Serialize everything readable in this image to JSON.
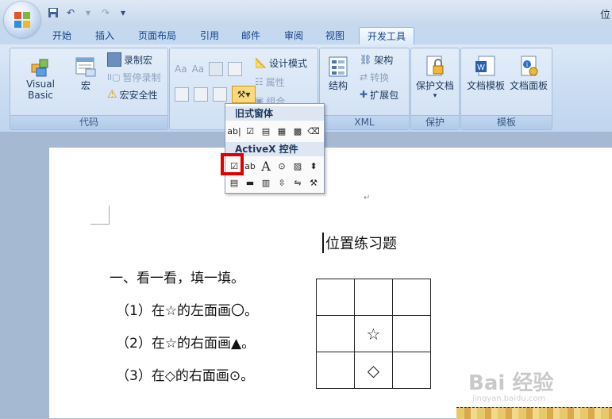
{
  "title_bar": {
    "title": "位"
  },
  "quick_access": {
    "icons": [
      "save-icon",
      "undo-icon",
      "redo-icon",
      "customize-icon"
    ]
  },
  "tabs": [
    "开始",
    "插入",
    "页面布局",
    "引用",
    "邮件",
    "审阅",
    "视图",
    "开发工具"
  ],
  "active_tab": "开发工具",
  "ribbon": {
    "code": {
      "label": "代码",
      "visual_basic": "Visual Basic",
      "macros": "宏",
      "record_macro": "录制宏",
      "pause_recording": "暂停录制",
      "macro_security": "宏安全性"
    },
    "controls": {
      "design_mode": "设计模式",
      "properties": "属性",
      "group": "组合"
    },
    "xml": {
      "label": "XML",
      "structure": "结构",
      "schema": "架构",
      "transform": "转换",
      "expansion_packs": "扩展包"
    },
    "protect": {
      "label": "保护",
      "protect_document": "保护文档"
    },
    "templates": {
      "label": "模板",
      "document_template": "文档模板",
      "document_panel": "文档面板"
    }
  },
  "dropdown": {
    "legacy_header": "旧式窗体",
    "activex_header": "ActiveX 控件",
    "legacy_icons": [
      "text-field-icon",
      "checkbox-icon",
      "combobox-icon",
      "frame-icon",
      "shading-icon",
      "eraser-icon"
    ],
    "activex_row1": [
      "checkbox-icon",
      "textbox-icon",
      "label-icon",
      "option-button-icon",
      "image-icon",
      "spin-button-icon"
    ],
    "activex_row2": [
      "listbox-icon",
      "command-button-icon",
      "combobox-icon",
      "scrollbar-icon",
      "toggle-icon",
      "more-controls-icon"
    ],
    "legacy_text_field": "ab|",
    "label_glyph": "A"
  },
  "document": {
    "title": "位置练习题",
    "section": "一、看一看，填一填。",
    "items": [
      "（1）在☆的左面画〇。",
      "（2）在☆的右面画▲。",
      "（3）在◇的右面画⊙。"
    ],
    "grid": [
      [
        "",
        "",
        ""
      ],
      [
        "",
        "☆",
        ""
      ],
      [
        "",
        "◇",
        ""
      ]
    ]
  },
  "watermark": {
    "text": "Bai 经验",
    "sub": "jingyan.baidu.com"
  }
}
